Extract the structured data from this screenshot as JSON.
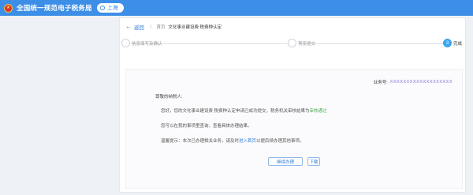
{
  "header": {
    "app_title": "全国统一规范电子税务局",
    "region": "上海"
  },
  "breadcrumb": {
    "back": "返回",
    "home": "首页",
    "current": "文化事业建设费 税费种认定"
  },
  "steps": [
    {
      "label": "信息填写及确认",
      "number": "",
      "active": false
    },
    {
      "label": "预览提交",
      "number": "",
      "active": false
    },
    {
      "label": "完成",
      "number": "3",
      "active": true
    }
  ],
  "result": {
    "serial_label": "业务号:",
    "serial_value": "XXXXXXXXXXXXXXXXXXX",
    "greeting": "尊敬的纳税人:",
    "para1_prefix": "您好，您的文化事业建设费 税费种认定申请已成功提交，税务机关审核结果为",
    "para1_status": "审核通过",
    "para2": "您可以在我的事项里查询，查看具体办理结果。",
    "para3_prefix": "温馨提示：本次已办理相关业务，请及时",
    "para3_link": "进入首页",
    "para3_suffix": "以便后续办理其他事项。",
    "btn_continue": "继续办理",
    "btn_download": "下载"
  }
}
